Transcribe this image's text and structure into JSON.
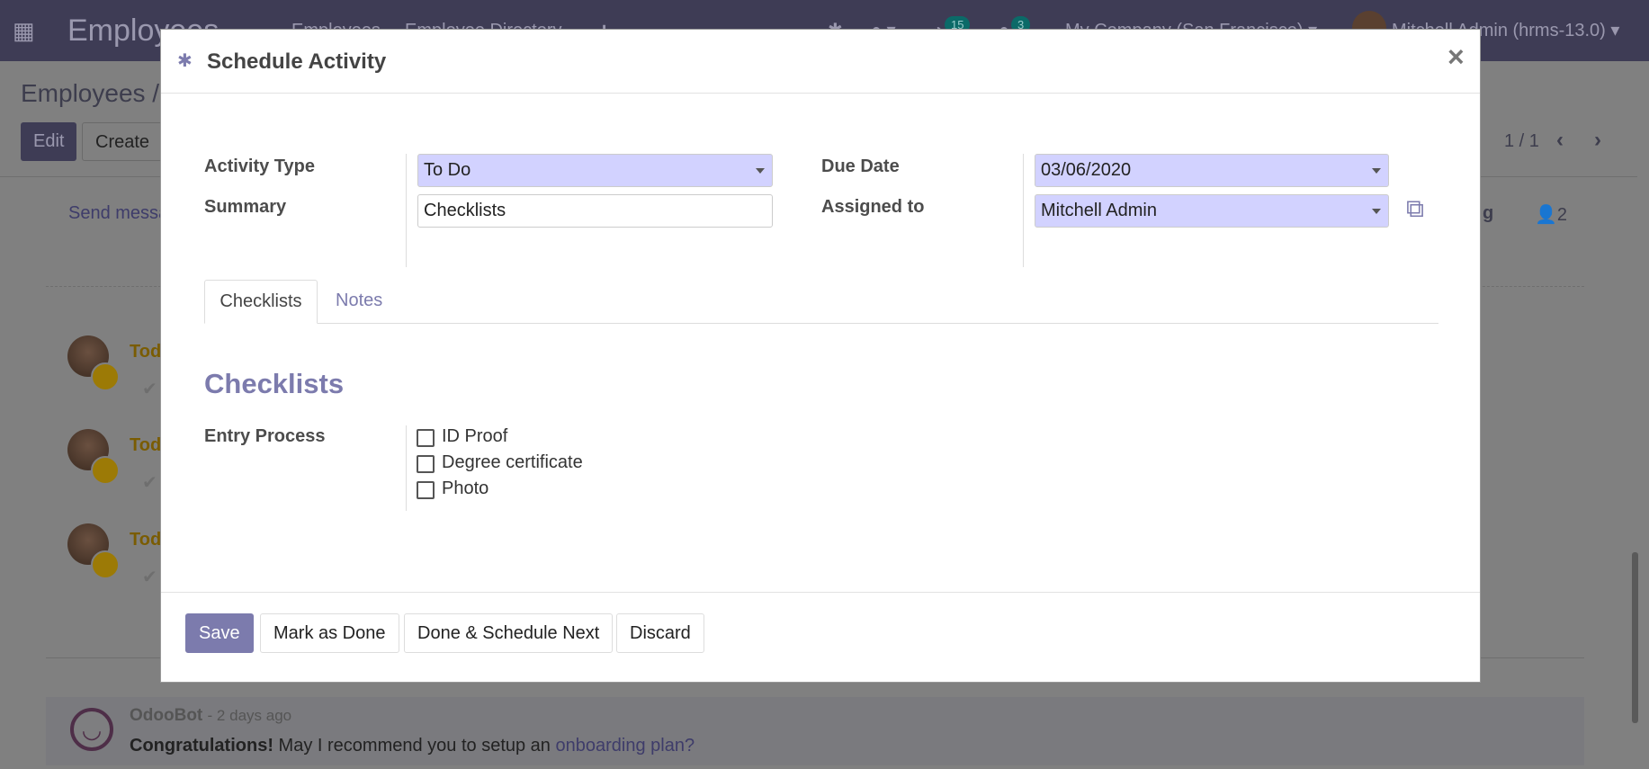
{
  "navbar": {
    "app_title": "Employees",
    "menu": [
      "Employees",
      "Employee Directory"
    ],
    "plus": "+",
    "activity_count": "15",
    "message_count": "3",
    "company": "My Company (San Francisco)",
    "user": "Mitchell Admin (hrms-13.0)"
  },
  "control_panel": {
    "breadcrumb": "Employees /",
    "edit": "Edit",
    "create": "Create",
    "pager": "1 / 1"
  },
  "chatter": {
    "send_message": "Send messa",
    "log_fragment": "g",
    "followers": "2",
    "activity_rows": [
      "Tod",
      "Tod",
      "Tod"
    ],
    "message": {
      "author": "OdooBot",
      "time": "- 2 days ago",
      "bold": "Congratulations!",
      "text": " May I recommend you to setup an ",
      "link": "onboarding plan?"
    }
  },
  "modal": {
    "title": "Schedule Activity",
    "close": "×",
    "fields": {
      "activity_type_label": "Activity Type",
      "activity_type": "To Do",
      "summary_label": "Summary",
      "summary": "Checklists",
      "due_date_label": "Due Date",
      "due_date": "03/06/2020",
      "assigned_label": "Assigned to",
      "assigned": "Mitchell Admin"
    },
    "tabs": [
      {
        "label": "Checklists",
        "active": true
      },
      {
        "label": "Notes",
        "active": false
      }
    ],
    "section_title": "Checklists",
    "entry_label": "Entry Process",
    "checklist": [
      {
        "label": "ID Proof",
        "checked": false
      },
      {
        "label": "Degree certificate",
        "checked": false
      },
      {
        "label": "Photo",
        "checked": false
      }
    ],
    "buttons": {
      "save": "Save",
      "mark_done": "Mark as Done",
      "done_next": "Done & Schedule Next",
      "discard": "Discard"
    }
  },
  "colors": {
    "primary": "#7c7bad",
    "required_field": "#d2d2ff",
    "navbar": "#3e3c55"
  }
}
